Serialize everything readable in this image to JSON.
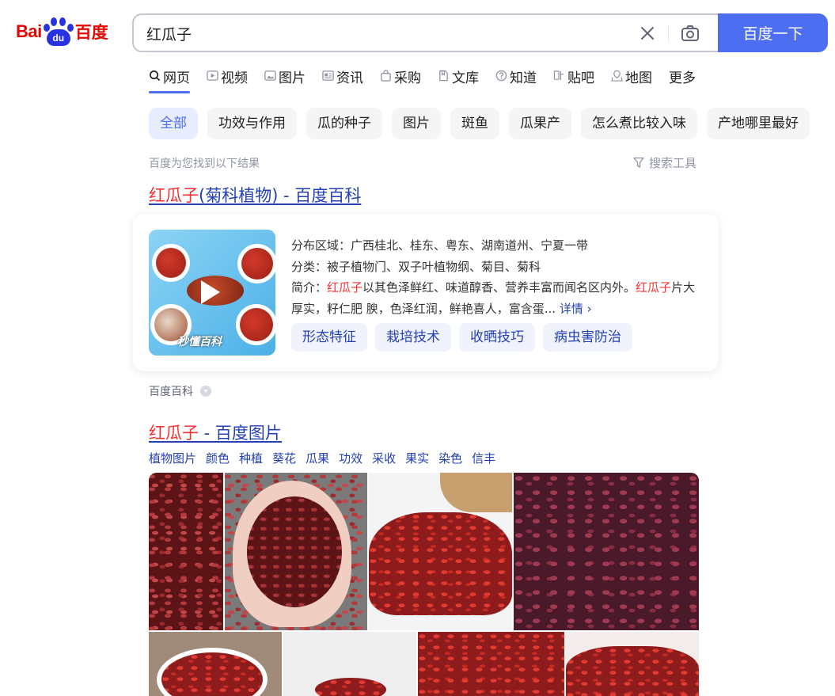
{
  "logo": {
    "text_bai": "Bai",
    "text_du": "du",
    "text_chinese": "百度"
  },
  "search": {
    "query": "红瓜子",
    "button_label": "百度一下"
  },
  "tabs": [
    {
      "label": "网页",
      "icon": "search-icon",
      "active": true
    },
    {
      "label": "视频",
      "icon": "video-icon"
    },
    {
      "label": "图片",
      "icon": "image-icon"
    },
    {
      "label": "资讯",
      "icon": "news-icon"
    },
    {
      "label": "采购",
      "icon": "shopping-bag-icon"
    },
    {
      "label": "文库",
      "icon": "document-icon"
    },
    {
      "label": "知道",
      "icon": "question-icon"
    },
    {
      "label": "贴吧",
      "icon": "tieba-icon"
    },
    {
      "label": "地图",
      "icon": "map-icon"
    },
    {
      "label": "更多"
    }
  ],
  "filter_chips": [
    "全部",
    "功效与作用",
    "瓜的种子",
    "图片",
    "斑鱼",
    "瓜果产",
    "怎么煮比较入味",
    "产地哪里最好"
  ],
  "result_count": "百度为您找到以下结果",
  "search_tools": "搜索工具",
  "result1": {
    "title_em": "红瓜子",
    "title_rest": "(菊科植物) - 百度百科",
    "thumb_watermark": "秒懂百科",
    "distribution": "分布区域：广西桂北、桂东、粤东、湖南道州、宁夏一带",
    "classification": "分类：被子植物门、双子叶植物纲、菊目、菊科",
    "intro_prefix": "简介：",
    "intro_em1": "红瓜子",
    "intro_mid": "以其色泽鲜红、味道醇香、营养丰富而闻名区内外。",
    "intro_em2": "红瓜子",
    "intro_rest": "片大厚实，籽仁肥 腴，色泽红润，鲜艳喜人，富含蛋...",
    "more_label": "详情",
    "chips": [
      "形态特征",
      "栽培技术",
      "收晒技巧",
      "病虫害防治"
    ],
    "source": "百度百科"
  },
  "result2": {
    "title_em": "红瓜子",
    "title_rest": " - 百度图片",
    "tags": [
      "植物图片",
      "颜色",
      "种植",
      "葵花",
      "瓜果",
      "功效",
      "采收",
      "果实",
      "染色",
      "信丰"
    ]
  },
  "colors": {
    "brand_blue": "#4e6ef2",
    "link_blue": "#2440b3",
    "highlight_red": "#f73131",
    "logo_red": "#e10601",
    "logo_blue": "#2932e1"
  }
}
